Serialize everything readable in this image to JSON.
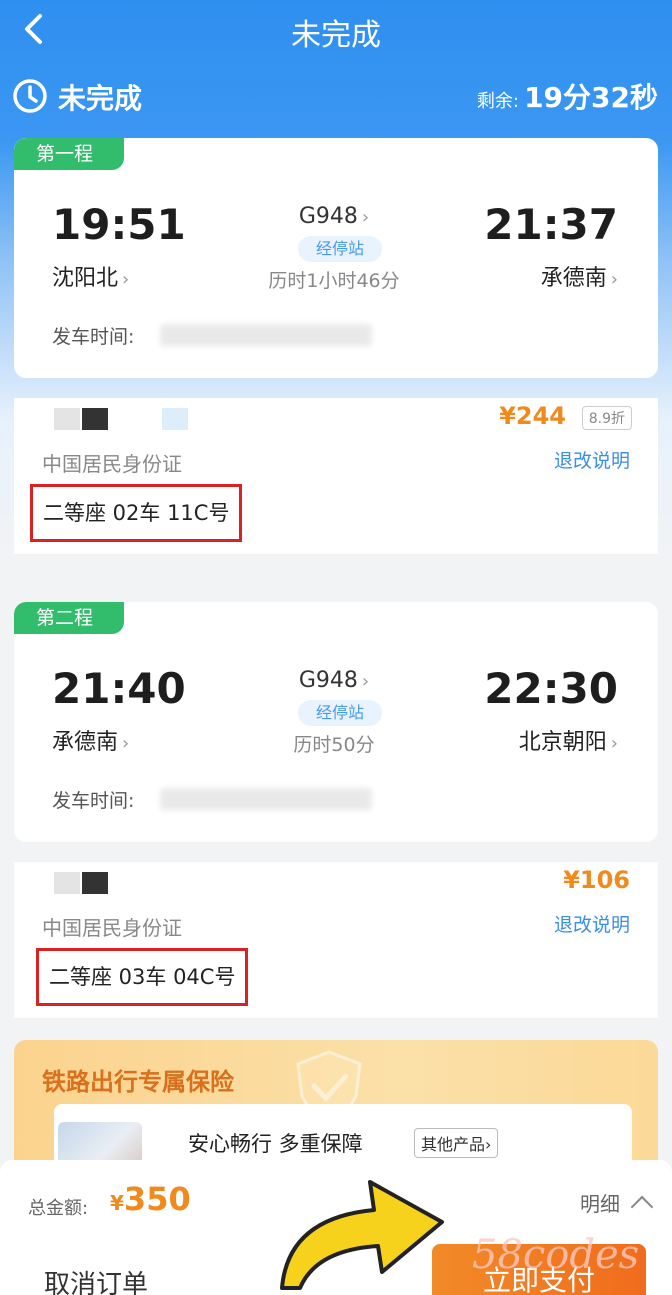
{
  "nav": {
    "title": "未完成"
  },
  "status": {
    "label": "未完成",
    "remaining_label": "剩余:",
    "remaining_value": "19分32秒"
  },
  "legs": [
    {
      "badge": "第一程",
      "dep_time": "19:51",
      "dep_station": "沈阳北",
      "arr_time": "21:37",
      "arr_station": "承德南",
      "train_no": "G948",
      "stops_label": "经停站",
      "duration": "历时1小时46分",
      "depart_label": "发车时间:",
      "price": "¥244",
      "discount": "8.9折",
      "id_type": "中国居民身份证",
      "refund_link": "退改说明",
      "seat": "二等座 02车 11C号"
    },
    {
      "badge": "第二程",
      "dep_time": "21:40",
      "dep_station": "承德南",
      "arr_time": "22:30",
      "arr_station": "北京朝阳",
      "train_no": "G948",
      "stops_label": "经停站",
      "duration": "历时50分",
      "depart_label": "发车时间:",
      "price": "¥106",
      "id_type": "中国居民身份证",
      "refund_link": "退改说明",
      "seat": "二等座 03车 04C号"
    }
  ],
  "insurance": {
    "title": "铁路出行专属保险",
    "slogan": "安心畅行 多重保障",
    "other_products": "其他产品"
  },
  "footer": {
    "total_label": "总金额:",
    "total_currency": "¥",
    "total_amount": "350",
    "detail_label": "明细",
    "cancel_label": "取消订单",
    "pay_label": "立即支付"
  },
  "watermark": "58codes",
  "colors": {
    "primary_blue": "#3b97f2",
    "accent_orange": "#f08a1d",
    "badge_green": "#32bd6d",
    "highlight_red": "#d72323",
    "link_blue": "#3b8ee8"
  }
}
